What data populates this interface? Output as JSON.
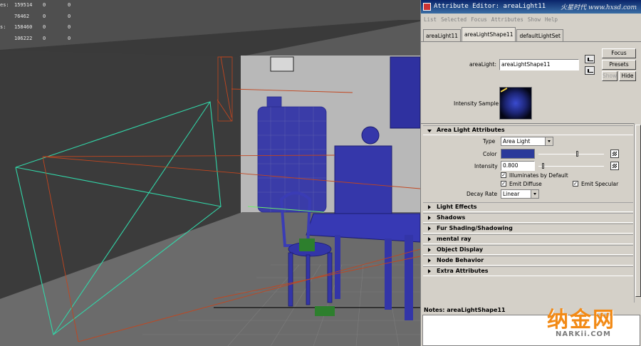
{
  "viewport": {
    "hud_rows": [
      {
        "label": "es:",
        "a": "159514",
        "b": "0",
        "c": "0"
      },
      {
        "label": "",
        "a": "76462",
        "b": "0",
        "c": "0"
      },
      {
        "label": "s:",
        "a": "158460",
        "b": "0",
        "c": "0"
      },
      {
        "label": "",
        "a": "106222",
        "b": "0",
        "c": "0"
      }
    ]
  },
  "editor": {
    "title": "Attribute Editor: areaLight11",
    "watermark": "火星时代 www.hxsd.com",
    "menu": [
      "List",
      "Selected",
      "Focus",
      "Attributes",
      "Show",
      "Help"
    ],
    "tabs": [
      "areaLight11",
      "areaLightShape11",
      "defaultLightSet"
    ],
    "node_label": "areaLight:",
    "node_value": "areaLightShape11",
    "buttons": {
      "focus": "Focus",
      "presets": "Presets",
      "show": "Show",
      "hide": "Hide"
    },
    "intensity_sample_label": "Intensity Sample",
    "area_light": {
      "header": "Area Light Attributes",
      "type_label": "Type",
      "type_value": "Area Light",
      "color_label": "Color",
      "color_hex": "#2b3a9a",
      "intensity_label": "Intensity",
      "intensity_value": "0.800",
      "intensity_fraction": 0.08,
      "color_value_fraction": 0.6,
      "illuminates_label": "Illuminates by Default",
      "emit_diffuse_label": "Emit Diffuse",
      "emit_specular_label": "Emit Specular",
      "decay_label": "Decay Rate",
      "decay_value": "Linear"
    },
    "collapsed_sections": [
      "Light Effects",
      "Shadows",
      "Fur Shading/Shadowing",
      "mental ray",
      "Object Display",
      "Node Behavior",
      "Extra Attributes"
    ],
    "notes_label": "Notes:  areaLightShape11"
  },
  "logo": {
    "chinese": "纳金网",
    "site": "NARKii.COM"
  }
}
